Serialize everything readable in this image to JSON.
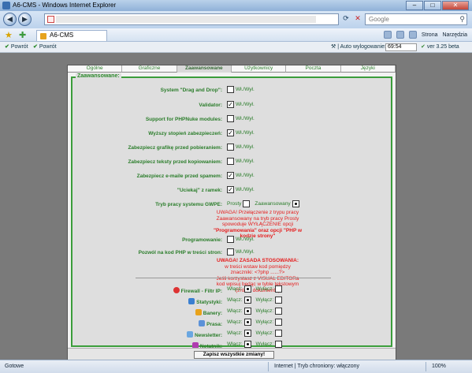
{
  "window": {
    "title": "A6-CMS - Windows Internet Explorer"
  },
  "browser": {
    "search_placeholder": "Google",
    "tab_title": "A6-CMS",
    "tools": {
      "strona": "Strona",
      "narzedzia": "Narzędzia"
    }
  },
  "toolbar": {
    "back1": "Powrót",
    "back2": "Powrót",
    "autosave_label": "Auto wylogowanie:",
    "autosave_value": "69:54",
    "version": "ver 3.25 beta"
  },
  "tabs": [
    "Ogólne",
    "Graficzne",
    "Zaawansowane",
    "Użytkownicy",
    "Poczta",
    "Języki"
  ],
  "active_tab": "Zaawansowane",
  "group_title": "Zaawansowane:",
  "onoff": "Wł./Wył.",
  "settings": [
    {
      "label": "System \"Drag and Drop\":",
      "checked": false
    },
    {
      "label": "Validator:",
      "checked": true
    },
    {
      "label": "Support for PHPNuke modules:",
      "checked": false
    },
    {
      "label": "Wyższy stopień zabezpieczeń:",
      "checked": true
    },
    {
      "label": "Zabezpiecz grafikę przed pobieraniem:",
      "checked": false
    },
    {
      "label": "Zabezpiecz teksty przed kopiowaniem:",
      "checked": false
    },
    {
      "label": "Zabezpiecz e-maile przed spamem:",
      "checked": true
    },
    {
      "label": "\"Uciekaj\" z ramek:",
      "checked": true
    }
  ],
  "gwpe": {
    "label": "Tryb pracy systemu GWPE:",
    "prosty": "Prosty",
    "zaawansowany": "Zaawansowany",
    "warn1": "UWAGA! Przełączenie z trypu pracy",
    "warn2": "Zaawansowany na tryb pracy Prosty",
    "warn3": "spowoduje WYŁĄCZENIE opcji",
    "warn4": "\"Programowania\" oraz opcji \"PHP w kodzie strony\""
  },
  "programowanie": {
    "label": "Programowanie:",
    "checked": false
  },
  "php": {
    "label": "Pozwól na kod PHP w treści stron:",
    "checked": false,
    "warn_title": "UWAGA! ZASADA STOSOWANIA:",
    "warn1": "w treści wstaw kod pomiędzy",
    "warn2": "znaczniki: <?php ......?>",
    "warn3": "Jeśli korzystasz z VISUAL EDITORa",
    "warn4": "kod wpisuj będąc w tyble tekstowym",
    "warn5": "(źródło dokumentu)"
  },
  "modules_on": "Włącz:",
  "modules_off": "Wyłącz:",
  "modules": [
    {
      "label": "Firewall - Filtr IP:",
      "icon": "firewall-icon",
      "color": "#d33"
    },
    {
      "label": "Statystyki:",
      "icon": "stats-icon",
      "color": "#3a7fd1"
    },
    {
      "label": "Banery:",
      "icon": "banner-icon",
      "color": "#e8a21a"
    },
    {
      "label": "Prasa:",
      "icon": "press-icon",
      "color": "#5c92d8"
    },
    {
      "label": "Newsletter:",
      "icon": "newsletter-icon",
      "color": "#6aa6e0"
    },
    {
      "label": "Notatnik:",
      "icon": "notepad-icon",
      "color": "#b03bb0"
    }
  ],
  "save_label": "Zapisz wszystkie zmiany!",
  "status": {
    "left": "Gotowe",
    "zone": "Internet | Tryb chroniony: włączony",
    "zoom": "100%"
  }
}
